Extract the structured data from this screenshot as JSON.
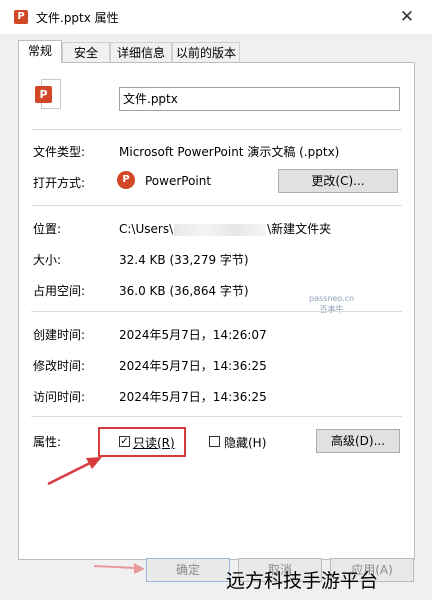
{
  "window": {
    "title": "文件.pptx 属性",
    "close_glyph": "✕"
  },
  "tabs": [
    {
      "label": "常规",
      "active": true
    },
    {
      "label": "安全",
      "active": false
    },
    {
      "label": "详细信息",
      "active": false
    },
    {
      "label": "以前的版本",
      "active": false
    }
  ],
  "general": {
    "file_name": "文件.pptx",
    "type_label": "文件类型:",
    "type_value": "Microsoft PowerPoint 演示文稿 (.pptx)",
    "opens_label": "打开方式:",
    "opens_value": "PowerPoint",
    "change_button": "更改(C)...",
    "location_label": "位置:",
    "location_prefix": "C:\\Users\\",
    "location_suffix": "\\新建文件夹",
    "size_label": "大小:",
    "size_value": "32.4 KB (33,279 字节)",
    "disk_label": "占用空间:",
    "disk_value": "36.0 KB (36,864 字节)",
    "created_label": "创建时间:",
    "created_value": "2024年5月7日，14:26:07",
    "modified_label": "修改时间:",
    "modified_value": "2024年5月7日，14:36:25",
    "accessed_label": "访问时间:",
    "accessed_value": "2024年5月7日，14:36:25",
    "attributes_label": "属性:",
    "readonly_label": "只读(R)",
    "readonly_checked": true,
    "hidden_label": "隐藏(H)",
    "hidden_checked": false,
    "advanced_button": "高级(D)..."
  },
  "watermark": {
    "line1": "passneo.cn",
    "line2": "百事牛"
  },
  "footer": {
    "ok": "确定",
    "cancel": "取消",
    "apply": "应用(A)"
  },
  "caption": "远方科技手游平台",
  "colors": {
    "accent_red": "#d63a3a",
    "ppt_orange": "#d24726"
  },
  "icons": {
    "file_type": "powerpoint-file-icon",
    "app": "powerpoint-app-icon",
    "check": "✓"
  }
}
